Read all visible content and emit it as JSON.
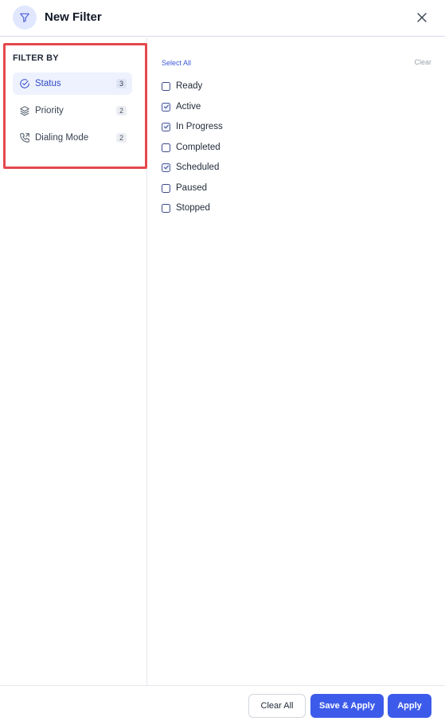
{
  "header": {
    "title": "New Filter",
    "icon": "filter-icon"
  },
  "sidebar": {
    "heading": "FILTER BY",
    "items": [
      {
        "label": "Status",
        "count": "3",
        "icon": "check-circle-icon",
        "active": true
      },
      {
        "label": "Priority",
        "count": "2",
        "icon": "layers-icon",
        "active": false
      },
      {
        "label": "Dialing Mode",
        "count": "2",
        "icon": "phone-forward-icon",
        "active": false
      }
    ]
  },
  "content": {
    "select_all": "Select All",
    "clear": "Clear",
    "options": [
      {
        "label": "Ready",
        "checked": false
      },
      {
        "label": "Active",
        "checked": true
      },
      {
        "label": "In Progress",
        "checked": true
      },
      {
        "label": "Completed",
        "checked": false
      },
      {
        "label": "Scheduled",
        "checked": true
      },
      {
        "label": "Paused",
        "checked": false
      },
      {
        "label": "Stopped",
        "checked": false
      }
    ]
  },
  "footer": {
    "clear_all": "Clear All",
    "save_apply": "Save & Apply",
    "apply": "Apply"
  },
  "colors": {
    "accent": "#3d5bea",
    "highlight": "#e5484d",
    "active_bg": "#eef2ff"
  }
}
